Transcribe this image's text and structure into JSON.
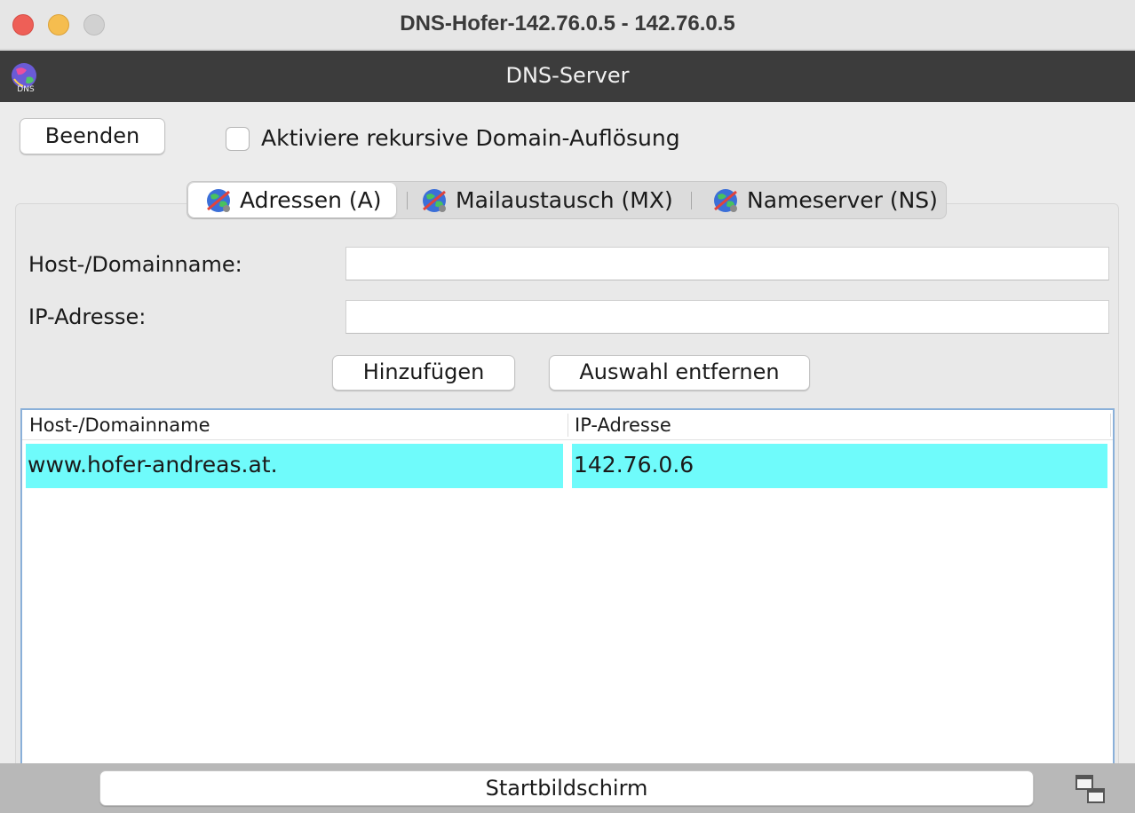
{
  "window": {
    "title": "DNS-Hofer-142.76.0.5 - 142.76.0.5"
  },
  "app": {
    "header_title": "DNS-Server",
    "logo_icon": "dns-globe-icon",
    "logo_text": "DNS"
  },
  "toolbar": {
    "quit_label": "Beenden",
    "recursive_label": "Aktiviere rekursive Domain-Auflösung",
    "recursive_checked": false
  },
  "tabs": [
    {
      "label": "Adressen (A)",
      "icon": "globe-network-icon",
      "active": true
    },
    {
      "label": "Mailaustausch (MX)",
      "icon": "globe-network-icon",
      "active": false
    },
    {
      "label": "Nameserver (NS)",
      "icon": "globe-network-icon",
      "active": false
    }
  ],
  "form": {
    "host_label": "Host-/Domainname:",
    "host_value": "",
    "ip_label": "IP-Adresse:",
    "ip_value": "",
    "add_label": "Hinzufügen",
    "remove_label": "Auswahl entfernen"
  },
  "table": {
    "columns": [
      "Host-/Domainname",
      "IP-Adresse"
    ],
    "rows": [
      [
        "www.hofer-andreas.at.",
        "142.76.0.6"
      ]
    ],
    "selected_color": "#6ffbfb"
  },
  "footer": {
    "home_label": "Startbildschirm",
    "window_icon": "windows-overlap-icon"
  },
  "colors": {
    "header_bg": "#3c3c3c",
    "close": "#ee5f57",
    "minimize": "#f5bd4f",
    "maximize": "#d1d1d1"
  }
}
